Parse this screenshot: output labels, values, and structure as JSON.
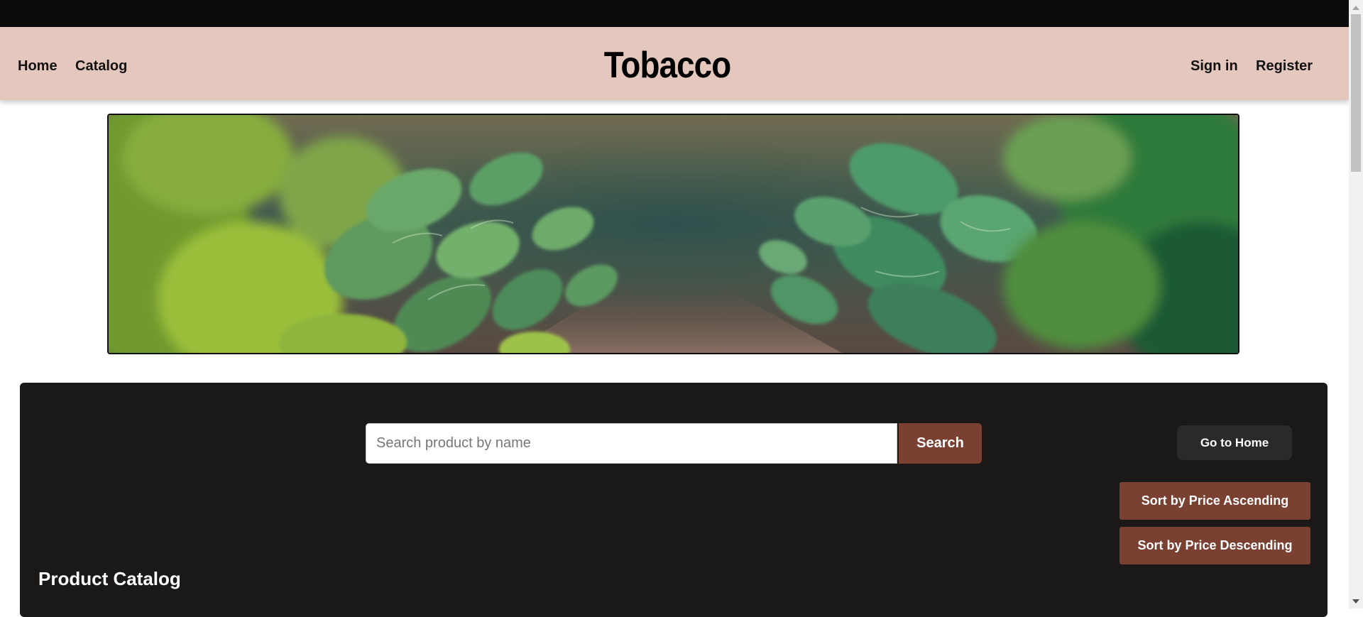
{
  "nav": {
    "home_label": "Home",
    "catalog_label": "Catalog",
    "brand": "Tobacco",
    "signin_label": "Sign in",
    "register_label": "Register"
  },
  "hero": {
    "image": "tobacco-field-banner"
  },
  "catalog": {
    "search_placeholder": "Search product by name",
    "search_value": "",
    "search_button_label": "Search",
    "home_button_label": "Go to Home",
    "sort_asc_label": "Sort by Price Ascending",
    "sort_desc_label": "Sort by Price Descending",
    "title": "Product Catalog"
  },
  "colors": {
    "topbar": "#0c0c0c",
    "navbar": "#e4c8bd",
    "panel": "#1b1918",
    "accent_brown": "#7a4032",
    "home_button": "#2a2a2a"
  }
}
